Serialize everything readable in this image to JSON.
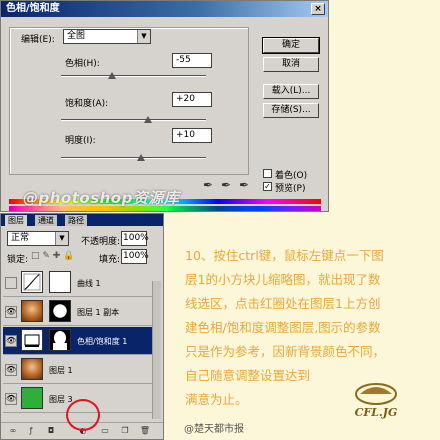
{
  "dialog": {
    "title": "色相/饱和度",
    "edit_label": "编辑(E):",
    "edit_value": "全图",
    "hue_label": "色相(H):",
    "hue_value": "-55",
    "hue_fraction": 0.35,
    "saturation_label": "饱和度(A):",
    "saturation_value": "+20",
    "saturation_fraction": 0.6,
    "lightness_label": "明度(I):",
    "lightness_value": "+10",
    "lightness_fraction": 0.55,
    "buttons": {
      "ok": "确定",
      "cancel": "取消",
      "load": "载入(L)...",
      "save": "存储(S)..."
    },
    "colorize_label": "着色(O)",
    "colorize_checked": false,
    "preview_label": "预览(P)",
    "preview_checked": true
  },
  "watermark": "@photoshop资源库",
  "layers_panel": {
    "tabs": [
      "图层",
      "通道",
      "路径"
    ],
    "blend_mode": "正常",
    "opacity_label": "不透明度:",
    "opacity_value": "100%",
    "lock_label": "锁定:",
    "fill_label": "填充:",
    "fill_value": "100%",
    "layers": [
      {
        "name": "曲线 1",
        "visible": false,
        "active": false
      },
      {
        "name": "图层 1 副本",
        "visible": true,
        "active": false
      },
      {
        "name": "色相/饱和度 1",
        "visible": true,
        "active": true
      },
      {
        "name": "图层 1",
        "visible": true,
        "active": false
      },
      {
        "name": "图层 3",
        "visible": true,
        "active": false
      }
    ]
  },
  "caption": {
    "lines": [
      "10、按住ctrl键，鼠标左键点一下图",
      "层1的小方块儿缩略图，就出现了数",
      "线选区，点击红圈处在图层1上方创",
      "建色相/饱和度调整图层,图示的参数",
      "只是作为参考，因新背景颜色不同，",
      "自己随意调整设置达到",
      "满意为止。"
    ]
  },
  "logo_text": "CFL.JG",
  "credit": "@楚天都市报",
  "colors": {
    "caption": "#e8a83c",
    "highlight_circle": "#e0141e",
    "selection": "#0a246a"
  }
}
